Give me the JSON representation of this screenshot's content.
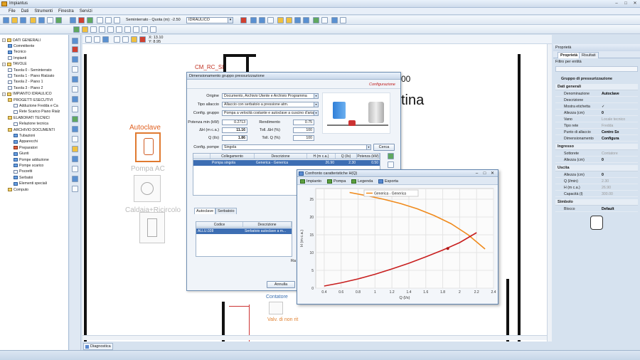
{
  "app": {
    "title": "Impiantus",
    "menu": [
      "File",
      "Dati",
      "Strumenti",
      "Finestra",
      "Servizi"
    ]
  },
  "toolbar": {
    "level_label": "Seminterrato - Quota (m): -2.50",
    "plant_combo": "IDRAULICO"
  },
  "draw": {
    "coord_x": "X: 13.10",
    "coord_y": "Y: 8.95"
  },
  "tree": {
    "items": [
      {
        "label": "DATI GENERALI",
        "level": 0,
        "icon": "folder-icon"
      },
      {
        "label": "Committente",
        "level": 1,
        "icon": "person-icon"
      },
      {
        "label": "Tecnico",
        "level": 1,
        "icon": "person-icon"
      },
      {
        "label": "Impianti",
        "level": 1,
        "icon": "document-icon"
      },
      {
        "label": "TAVOLE",
        "level": 0,
        "icon": "folder-icon"
      },
      {
        "label": "Tavola 0 - Seminterrato",
        "level": 1,
        "icon": "sheet-icon"
      },
      {
        "label": "Tavola 1 - Piano Rialzato",
        "level": 1,
        "icon": "sheet-icon"
      },
      {
        "label": "Tavola 2 - Piano 1",
        "level": 1,
        "icon": "sheet-icon"
      },
      {
        "label": "Tavola 3 - Piano 2",
        "level": 1,
        "icon": "sheet-icon"
      },
      {
        "label": "IMPIANTO IDRAULICO",
        "level": 0,
        "icon": "folder-icon"
      },
      {
        "label": "PROGETTI ESECUTIVI",
        "level": 1,
        "icon": "folder-icon"
      },
      {
        "label": "Adduzione Fredda e Ca",
        "level": 2,
        "icon": "document-icon"
      },
      {
        "label": "Rete Scarico Piano Rialz",
        "level": 2,
        "icon": "document-icon"
      },
      {
        "label": "ELABORATI TECNICI",
        "level": 1,
        "icon": "folder-icon"
      },
      {
        "label": "Relazione tecnica",
        "level": 2,
        "icon": "document-icon"
      },
      {
        "label": "ARCHIVIO DOCUMENTI",
        "level": 1,
        "icon": "folder-icon"
      },
      {
        "label": "Tubazioni",
        "level": 2,
        "icon": "pipe-icon"
      },
      {
        "label": "Apparecchi",
        "level": 2,
        "icon": "fixture-icon"
      },
      {
        "label": "Preparatori",
        "level": 2,
        "icon": "heater-icon"
      },
      {
        "label": "Giunti",
        "level": 2,
        "icon": "joint-icon"
      },
      {
        "label": "Pompe adduzione",
        "level": 2,
        "icon": "pump-icon"
      },
      {
        "label": "Pompe scarico",
        "level": 2,
        "icon": "pump-icon"
      },
      {
        "label": "Pozzetti",
        "level": 2,
        "icon": "manhole-icon"
      },
      {
        "label": "Serbatoi",
        "level": 2,
        "icon": "tank-icon"
      },
      {
        "label": "Elementi speciali",
        "level": 2,
        "icon": "special-icon"
      },
      {
        "label": "Computo",
        "level": 1,
        "icon": "calc-icon"
      }
    ]
  },
  "canvas": {
    "label_cm": "CM_RC_SI",
    "label_autoclave": "Autoclave",
    "label_pompa": "Pompa AC",
    "label_caldaia": "Caldaia+Ricircolo",
    "label_contatore": "Contatore",
    "label_valv": "Valv. di non rit",
    "big_text": "tina",
    "big_text2": "00"
  },
  "dialog": {
    "title": "Dimensionamento gruppo pressurizzazione",
    "config_link": "Configurazione",
    "origine_label": "Origine",
    "origine": "Documento, Archivio Utente e Archivio Programma",
    "tipo_label": "Tipo allaccio",
    "tipo": "Allaccio con serbatoio a pressione atm.",
    "config_label": "Config. gruppo",
    "config": "Pompa a velocità costante e autoclave a cuscino d'aria",
    "potenza_label": "Potenza min (kW)",
    "potenza": "0.2713",
    "rend_label": "Rendimento",
    "rend": "0.75",
    "dh_label": "ΔH (m c.a.)",
    "dh": "11.16",
    "tolh_label": "Toll. ΔH (%)",
    "tolh": "100",
    "q_label": "Q (l/s)",
    "q": "1.86",
    "tolq_label": "Toll. Q (%)",
    "tolq": "100",
    "configp_label": "Config. pompe",
    "configp": "Singola",
    "cerca": "Cerca",
    "grid_headers": [
      "Collegamento",
      "Descrizione",
      "H (m c.a.)",
      "Q (l/s)",
      "Potenza (kW)"
    ],
    "grid_row": [
      "Pompa singola",
      "Generica - Generica",
      "26.90",
      "2.30",
      "0.50"
    ],
    "tab_autoclave": "Autoclave",
    "tab_serbatoio": "Serbatoio",
    "grid2_headers": [
      "Codice",
      "Descrizione"
    ],
    "grid2_row": [
      "ALLU.028",
      "Serbatoio autoclave a m..."
    ],
    "annulla": "Annulla",
    "ra": "Ra"
  },
  "chartwin": {
    "title": "Confronto caratteristiche H(Q)",
    "buttons": [
      "Impianto",
      "Pompa",
      "Legenda",
      "Esporta"
    ],
    "legend": "Generica - Generica"
  },
  "chart_data": {
    "type": "line",
    "xlabel": "Q (l/s)",
    "ylabel": "H (m c.a.)",
    "xlim": [
      0.3,
      2.4
    ],
    "ylim": [
      0,
      28
    ],
    "xticks": [
      0.4,
      0.6,
      0.8,
      1,
      1.2,
      1.4,
      1.6,
      1.8,
      2,
      2.2,
      2.4
    ],
    "yticks": [
      0,
      5,
      10,
      15,
      20,
      25
    ],
    "grid": true,
    "series": [
      {
        "name": "Generica - Generica",
        "color": "#f08a1c",
        "x": [
          0.7,
          0.9,
          1.1,
          1.3,
          1.5,
          1.7,
          1.9,
          2.1,
          2.3
        ],
        "y": [
          26.9,
          26.0,
          25.0,
          23.8,
          22.3,
          20.4,
          18.1,
          15.0,
          11.0
        ]
      },
      {
        "color": "#c81e1e",
        "x": [
          0.4,
          0.6,
          0.8,
          1.0,
          1.2,
          1.4,
          1.6,
          1.8,
          2.0,
          2.2
        ],
        "y": [
          0.6,
          1.5,
          2.6,
          3.9,
          5.4,
          7.0,
          8.8,
          10.7,
          12.8,
          15.6
        ]
      }
    ],
    "point": {
      "x": 1.86,
      "y": 11.16
    }
  },
  "props": {
    "header": "Proprietà",
    "tab1": "Proprietà",
    "tab2": "Risultati",
    "filter": "Filtro per entità",
    "object": "Gruppo di pressurizzazione",
    "sec_dati": "Dati generali",
    "sec_ingresso": "Ingresso",
    "sec_uscita": "Uscita",
    "sec_simbolo": "Simbolo",
    "rows": [
      {
        "k": "Denominazione",
        "v": "Autoclave",
        "g": false
      },
      {
        "k": "Descrizione",
        "v": "",
        "g": false
      },
      {
        "k": "Mostra etichetta",
        "v": "✓",
        "g": false
      },
      {
        "k": "Altezza (cm)",
        "v": "0",
        "g": false
      },
      {
        "k": "Vano",
        "v": "Locale tecnico",
        "g": true
      },
      {
        "k": "Tipo rete",
        "v": "Fredda",
        "g": true
      },
      {
        "k": "Punto di allaccio",
        "v": "Centro Sx",
        "g": false
      },
      {
        "k": "Dimensionamento",
        "v": "Configura",
        "g": false
      }
    ],
    "rows_in": [
      {
        "k": "Sottorete",
        "v": "Contatore",
        "g": true
      },
      {
        "k": "Altezza (cm)",
        "v": "0",
        "g": false
      }
    ],
    "rows_out": [
      {
        "k": "Altezza (cm)",
        "v": "0",
        "g": false
      },
      {
        "k": "Q (l/min)",
        "v": "2.30",
        "g": true
      },
      {
        "k": "H (m c.a.)",
        "v": "26.90",
        "g": true
      },
      {
        "k": "Capacità (l)",
        "v": "300.00",
        "g": true
      }
    ],
    "rows_sym": [
      {
        "k": "Blocco",
        "v": "Default",
        "g": false
      }
    ]
  },
  "diag_tab": "Diagnostica"
}
